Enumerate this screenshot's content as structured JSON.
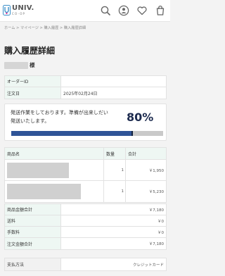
{
  "header": {
    "logo_main": "UNIV.",
    "logo_sub": "CO-OP",
    "brand_color": "#3a8fc9",
    "icons": [
      "search-icon",
      "account-icon",
      "heart-icon",
      "cart-icon"
    ]
  },
  "breadcrumb": "ホーム > マイページ > 購入履歴 > 購入履歴詳細",
  "page_title": "購入履歴詳細",
  "customer_suffix": "様",
  "order_info": [
    {
      "label": "オーダーID",
      "value": ""
    },
    {
      "label": "注文日",
      "value": "2025年02月24日"
    }
  ],
  "status": {
    "message": "発送作業をしております。準備が出来しだい発送いたします。",
    "percent_label": "80%",
    "progress": 0.8,
    "bar_color": "#2f5497"
  },
  "items": {
    "headers": {
      "name": "商品名",
      "qty": "数量",
      "total": "合計"
    },
    "rows": [
      {
        "qty": "1",
        "total": "￥1,950"
      },
      {
        "qty": "1",
        "total": "￥5,230"
      }
    ]
  },
  "summary": [
    {
      "label": "商品金額合計",
      "value": "￥7,180"
    },
    {
      "label": "送料",
      "value": "￥0"
    },
    {
      "label": "手数料",
      "value": "￥0"
    },
    {
      "label": "注文金額合計",
      "value": "￥7,180"
    }
  ],
  "payment": {
    "label": "支払方法",
    "value": "クレジットカード"
  }
}
